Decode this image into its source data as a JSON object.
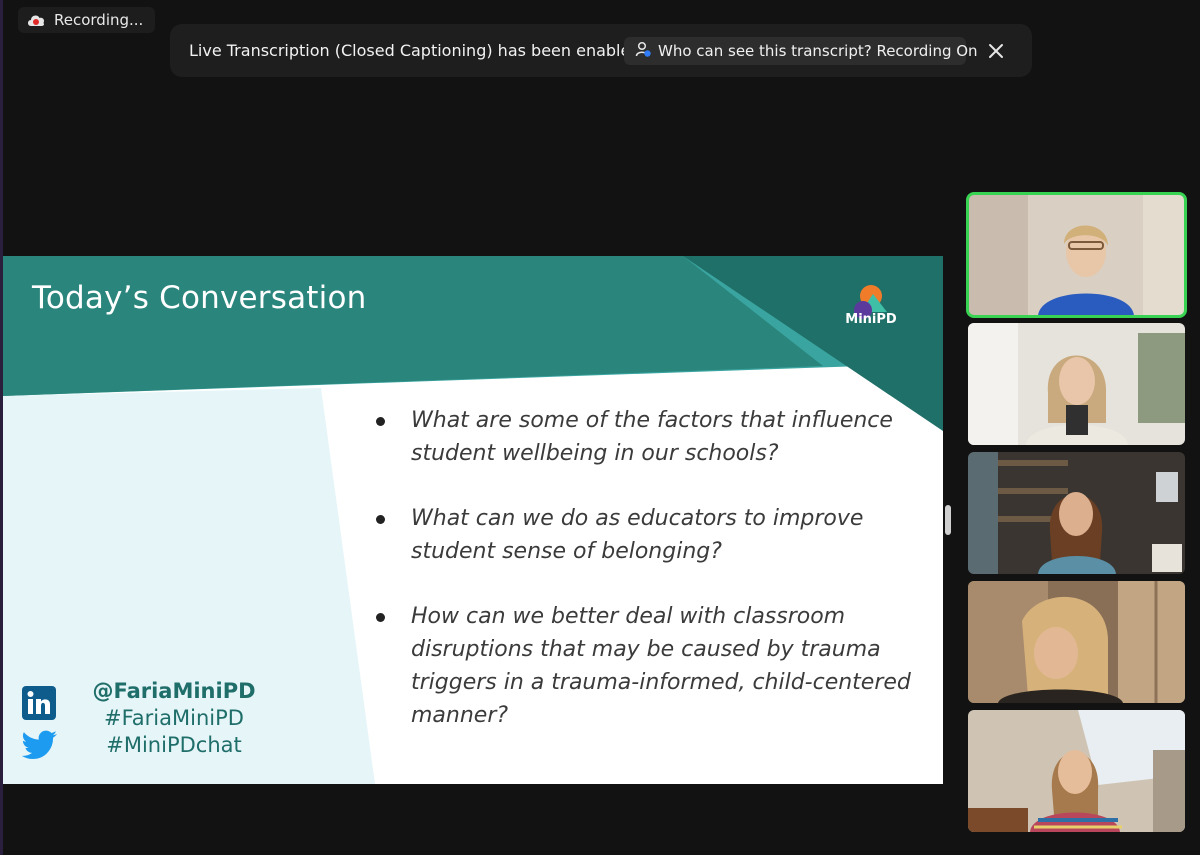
{
  "recording": {
    "label": "Recording..."
  },
  "notification": {
    "message": "Live Transcription (Closed Captioning) has been enabled",
    "button_label": "Who can see this transcript? Recording On",
    "close_icon": "close-icon"
  },
  "slide": {
    "title": "Today’s Conversation",
    "logo_text": "MiniPD",
    "bullets": [
      "What are some of the factors that influence student wellbeing in our schools?",
      "What can we do as educators to improve student sense of belonging?",
      "How can we better deal with classroom disruptions that may be caused by trauma triggers in a trauma-informed, child-centered manner?"
    ],
    "handles": [
      "@FariaMiniPD",
      "#FariaMiniPD",
      "#MiniPDchat"
    ],
    "social_icons": [
      "linkedin-icon",
      "twitter-icon"
    ]
  },
  "colors": {
    "teal_dark": "#227a72",
    "teal_light": "#3aa5a0",
    "light_panel": "#e6f5f8",
    "active_speaker": "#39d353"
  }
}
